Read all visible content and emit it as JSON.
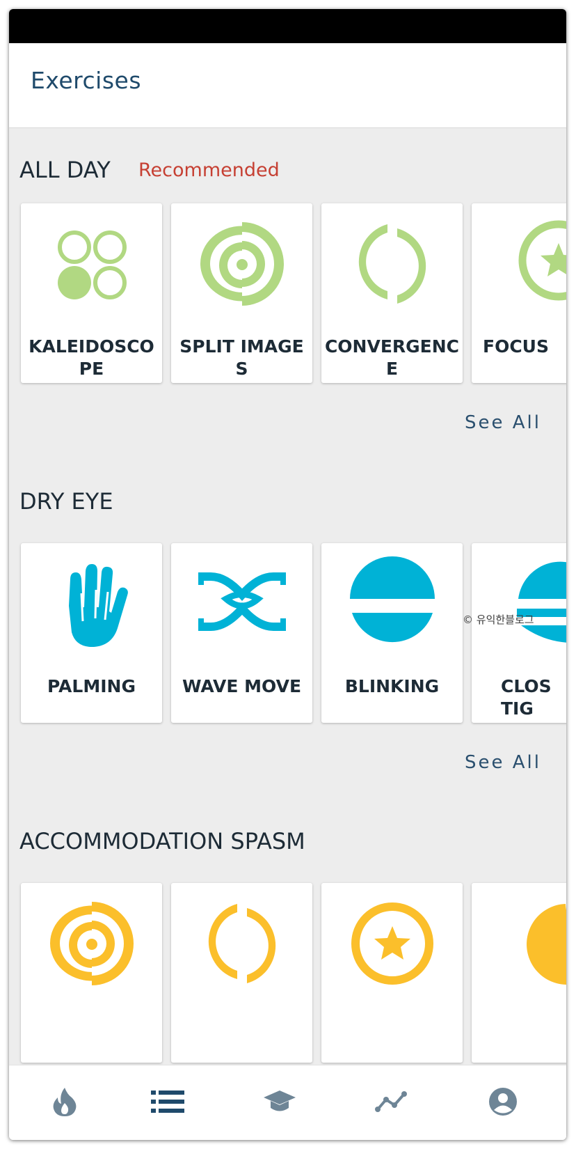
{
  "app_bar": {
    "title": "Exercises"
  },
  "sections": [
    {
      "title": "ALL DAY",
      "badge": "Recommended",
      "see_all": "See All",
      "cards": [
        {
          "label": "KALEIDOSCOPE",
          "icon": "kaleidoscope-icon"
        },
        {
          "label": "SPLIT IMAGES",
          "icon": "split-spiral-icon"
        },
        {
          "label": "CONVERGENCE",
          "icon": "convergence-icon"
        },
        {
          "label": "FOCUS",
          "icon": "focus-star-icon"
        }
      ]
    },
    {
      "title": "DRY EYE",
      "see_all": "See All",
      "cards": [
        {
          "label": "PALMING",
          "icon": "hand-icon"
        },
        {
          "label": "WAVE MOVE",
          "icon": "wave-icon"
        },
        {
          "label": "BLINKING",
          "icon": "blink-icon"
        },
        {
          "label": "CLOS TIG",
          "icon": "closed-eye-icon"
        }
      ]
    },
    {
      "title": "ACCOMMODATION SPASM",
      "cards": [
        {
          "icon": "split-spiral-icon"
        },
        {
          "icon": "convergence-icon"
        },
        {
          "icon": "focus-star-icon"
        },
        {
          "icon": "crescent-icon"
        }
      ]
    }
  ],
  "watermark": "© 유익한블로그",
  "bottom_nav": [
    {
      "icon": "flame-icon"
    },
    {
      "icon": "list-icon"
    },
    {
      "icon": "graduation-cap-icon"
    },
    {
      "icon": "trend-line-icon"
    },
    {
      "icon": "profile-icon"
    }
  ],
  "colors": {
    "green": "#b1d882",
    "blue": "#00b2d6",
    "yellow": "#fbbf2b",
    "title_blue": "#1f4a6b",
    "badge_red": "#c64033",
    "nav_grey": "#6e8596",
    "nav_active": "#1f4a6b"
  }
}
